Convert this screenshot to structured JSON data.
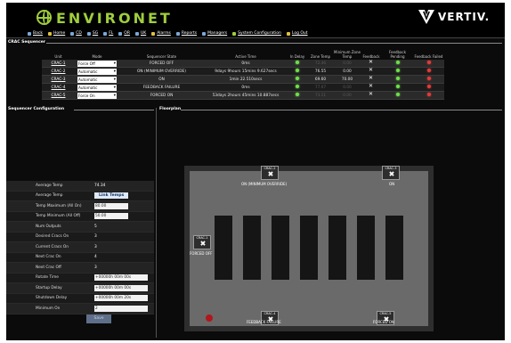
{
  "app": {
    "brand": "ENVIRONET",
    "vendor": "VERTIV."
  },
  "nav": [
    {
      "label": "Back",
      "icon": "arrow-left-icon"
    },
    {
      "label": "Home",
      "icon": "home-icon"
    },
    {
      "label": "CD",
      "icon": "page-icon"
    },
    {
      "label": "SG",
      "icon": "page-icon"
    },
    {
      "label": "FL",
      "icon": "page-icon"
    },
    {
      "label": "OR",
      "icon": "page-icon"
    },
    {
      "label": "UK",
      "icon": "page-icon"
    },
    {
      "label": "Alarms",
      "icon": "alarm-icon"
    },
    {
      "label": "Reports",
      "icon": "reports-icon"
    },
    {
      "label": "Managers",
      "icon": "managers-icon"
    },
    {
      "label": "System Configuration",
      "icon": "config-icon"
    },
    {
      "label": "Log Out",
      "icon": "logout-icon"
    }
  ],
  "sequencer": {
    "title": "CRAC Sequencer",
    "columns": [
      "Unit",
      "Mode",
      "Sequencer State",
      "Active Time",
      "In Delay",
      "Zone Temp",
      "Minimum Zone Temp",
      "Feedback",
      "Feedback Pending",
      "Feedback Failed"
    ],
    "rows": [
      {
        "unit": "CRAC-1",
        "mode": "Force Off",
        "state": "FORCED OFF",
        "time": "0ms",
        "delay": "green",
        "zone": "72.46",
        "min": "0.00",
        "pending": "green",
        "failed": "red",
        "dim": true
      },
      {
        "unit": "CRAC-2",
        "mode": "Automatic",
        "state": "ON (MINIMUM OVERRIDE)",
        "time": "9days 9hours 15mins 9.627secs",
        "delay": "green",
        "zone": "76.55",
        "min": "0.00",
        "pending": "green",
        "failed": "red",
        "dim": false
      },
      {
        "unit": "CRAC-3",
        "mode": "Automatic",
        "state": "ON",
        "time": "1min 22.510secs",
        "delay": "green",
        "zone": "69.60",
        "min": "70.00",
        "pending": "green",
        "failed": "red",
        "dim": false
      },
      {
        "unit": "CRAC-4",
        "mode": "Automatic",
        "state": "FEEDBACK FAILURE",
        "time": "0ms",
        "delay": "green",
        "zone": "77.07",
        "min": "0.00",
        "pending": "green",
        "failed": "red",
        "dim": true
      },
      {
        "unit": "CRAC-5",
        "mode": "Force On",
        "state": "FORCED ON",
        "time": "53days 2hours 45mins 10.887secs",
        "delay": "green",
        "zone": "73.11",
        "min": "0.00",
        "pending": "green",
        "failed": "red",
        "dim": true
      }
    ]
  },
  "config": {
    "title": "Sequencer Configuration",
    "avg_temp_label": "Average Temp",
    "avg_temp_value": "74.34",
    "avg_temp2_label": "Average Temp",
    "link_temps": "Link Temps",
    "temp_max_label": "Temp Maximum (All On)",
    "temp_max_value": "80.00",
    "temp_min_label": "Temp Minimum (All Off)",
    "temp_min_value": "50.00",
    "num_outputs_label": "Num Outputs",
    "num_outputs_value": "5",
    "desired_label": "Desired Cracs On",
    "desired_value": "3",
    "current_label": "Current Cracs On",
    "current_value": "3",
    "next_on_label": "Next Crac On",
    "next_on_value": "4",
    "next_off_label": "Next Crac Off",
    "next_off_value": "3",
    "rotate_label": "Rotate Time",
    "rotate_value": "+00000h 00m 00s",
    "startup_label": "Startup Delay",
    "startup_value": "+00000h 00m 00s",
    "shutdown_label": "Shutdown Delay",
    "shutdown_value": "+00000h 00m 20s",
    "minimum_label": "Minimum On",
    "minimum_value": "2",
    "save": "Save"
  },
  "floorplan": {
    "title": "Floorplan",
    "cracs": [
      {
        "name": "CRAC-2",
        "state": "ON (MINIMUM OVERRIDE)"
      },
      {
        "name": "CRAC-3",
        "state": "ON"
      },
      {
        "name": "CRAC-1",
        "state": "FORCED OFF"
      },
      {
        "name": "CRAC-4",
        "state": "FEEDBACK FAILURE"
      },
      {
        "name": "CRAC-5",
        "state": "FORCED ON"
      }
    ]
  },
  "colors": {
    "accent": "#9fce3c",
    "led_green": "#6ee04a",
    "led_red": "#e23b3b"
  }
}
